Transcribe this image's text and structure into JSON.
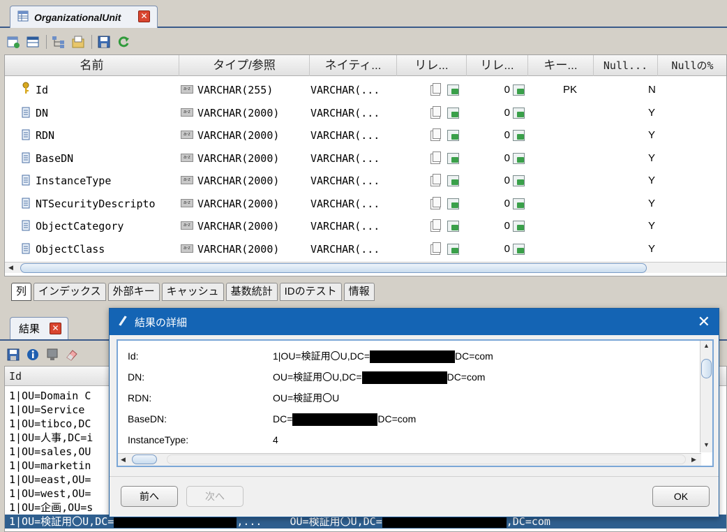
{
  "editor_tab": {
    "title": "OrganizationalUnit",
    "close": "✕"
  },
  "columns_header": [
    "名前",
    "タイプ/参照",
    "ネイティ...",
    "リレ...",
    "リレ...",
    "キー...",
    "Null...",
    "Nullの%"
  ],
  "rows": [
    {
      "name": "Id",
      "type": "VARCHAR(255)",
      "native": "VARCHAR(...",
      "rel_count": "0",
      "key": "PK",
      "null": "N",
      "icon": "key-icon"
    },
    {
      "name": "DN",
      "type": "VARCHAR(2000)",
      "native": "VARCHAR(...",
      "rel_count": "0",
      "key": "",
      "null": "Y",
      "icon": "column-icon"
    },
    {
      "name": "RDN",
      "type": "VARCHAR(2000)",
      "native": "VARCHAR(...",
      "rel_count": "0",
      "key": "",
      "null": "Y",
      "icon": "column-icon"
    },
    {
      "name": "BaseDN",
      "type": "VARCHAR(2000)",
      "native": "VARCHAR(...",
      "rel_count": "0",
      "key": "",
      "null": "Y",
      "icon": "column-icon"
    },
    {
      "name": "InstanceType",
      "type": "VARCHAR(2000)",
      "native": "VARCHAR(...",
      "rel_count": "0",
      "key": "",
      "null": "Y",
      "icon": "column-icon"
    },
    {
      "name": "NTSecurityDescripto",
      "type": "VARCHAR(2000)",
      "native": "VARCHAR(...",
      "rel_count": "0",
      "key": "",
      "null": "Y",
      "icon": "column-icon"
    },
    {
      "name": "ObjectCategory",
      "type": "VARCHAR(2000)",
      "native": "VARCHAR(...",
      "rel_count": "0",
      "key": "",
      "null": "Y",
      "icon": "column-icon"
    },
    {
      "name": "ObjectClass",
      "type": "VARCHAR(2000)",
      "native": "VARCHAR(...",
      "rel_count": "0",
      "key": "",
      "null": "Y",
      "icon": "column-icon"
    }
  ],
  "sub_tabs": [
    "列",
    "インデックス",
    "外部キー",
    "キャッシュ",
    "基数統計",
    "IDのテスト",
    "情報"
  ],
  "result_tab": {
    "title": "結果",
    "close": "✕"
  },
  "result_header": "Id",
  "result_rows": [
    "1|OU=Domain C",
    "1|OU=Service ",
    "1|OU=tibco,DC",
    "1|OU=人事,DC=i",
    "1|OU=sales,OU",
    "1|OU=marketin",
    "1|OU=east,OU=",
    "1|OU=west,OU=",
    "1|OU=企画,OU=s"
  ],
  "result_selected": {
    "part1": "1|OU=検証用〇U,DC=",
    "part2": ",...",
    "part3": "OU=検証用〇U,DC=",
    "part4": ",DC=com"
  },
  "dialog": {
    "title": "結果の詳細",
    "close": "✕",
    "fields": [
      {
        "label": "Id:",
        "prefix": "1|OU=検証用〇U,DC=",
        "redacted": true,
        "suffix": "DC=com"
      },
      {
        "label": "DN:",
        "prefix": "OU=検証用〇U,DC=",
        "redacted": true,
        "suffix": "DC=com"
      },
      {
        "label": "RDN:",
        "prefix": "OU=検証用〇U",
        "redacted": false,
        "suffix": ""
      },
      {
        "label": "BaseDN:",
        "prefix": "DC=",
        "redacted": true,
        "suffix": "DC=com"
      },
      {
        "label": "InstanceType:",
        "prefix": "4",
        "redacted": false,
        "suffix": ""
      }
    ],
    "prev_label": "前へ",
    "next_label": "次へ",
    "ok_label": "OK"
  },
  "icons": {
    "toolbar_top": [
      "add-column-icon",
      "table-icon",
      "relation-icon",
      "folder-icon",
      "save-icon",
      "refresh-icon"
    ],
    "toolbar_result": [
      "save-icon",
      "info-icon",
      "export-icon",
      "eraser-icon"
    ]
  },
  "colors": {
    "accent": "#1464b4",
    "selection": "#2f5f8f",
    "tab_border": "#3a5a8a"
  }
}
